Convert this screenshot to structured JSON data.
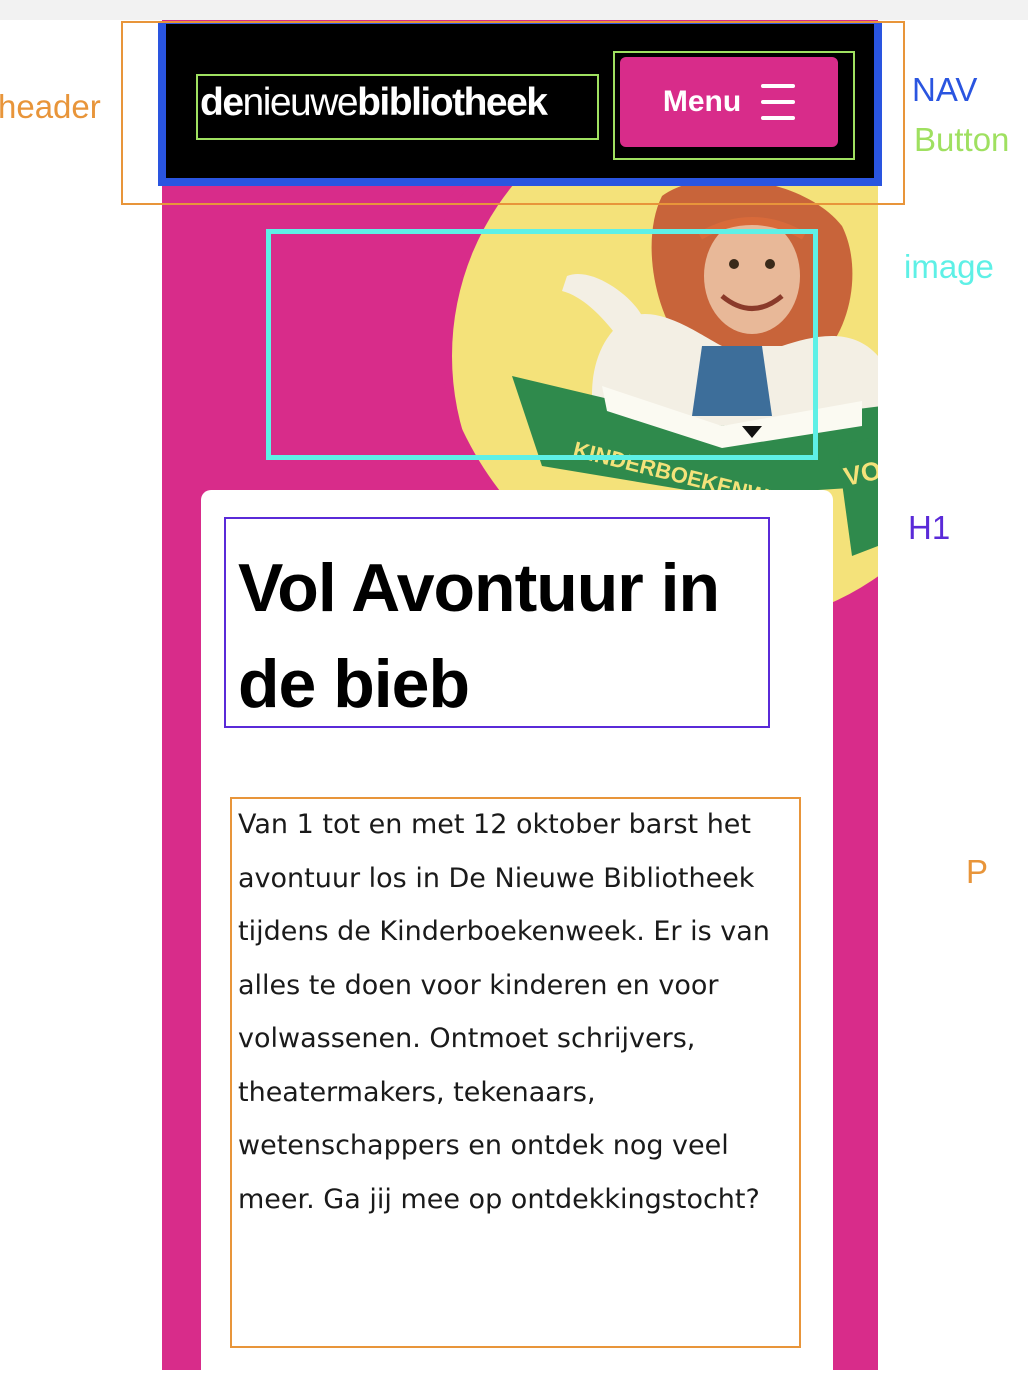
{
  "site": {
    "logo_de": "de",
    "logo_nieuwe": "nieuwe",
    "logo_bibliotheek": "bibliotheek",
    "menu_label": "Menu"
  },
  "content": {
    "heading": "Vol Avontuur in de bieb",
    "paragraph": "Van 1 tot en met 12 oktober barst het avontuur los in De Nieuwe Bibliotheek tijdens de Kinderboekenweek. Er is van alles te doen voor kinderen en voor volwassenen. Ontmoet schrijvers, theatermakers, tekenaars, wetenschappers en ontdek nog veel meer. Ga jij mee op ontdekkingstocht?"
  },
  "annotations": {
    "header": "header",
    "nav": "NAV",
    "button": "Button",
    "image": "image",
    "h1": "H1",
    "p": "P"
  },
  "illustration": {
    "book_text": "KINDERBOEKENWEEK",
    "side_text": "VOL"
  },
  "colors": {
    "brand_pink": "#d82c8a",
    "nav_black": "#000000",
    "nav_blue_outline": "#2a55e0",
    "header_annotation": "#e8953a",
    "button_annotation": "#9fe060",
    "image_annotation": "#5ef0e6",
    "h1_annotation": "#5a2ad8",
    "p_annotation": "#e8953a",
    "hero_yellow": "#f4e27a",
    "book_green": "#2f8a4c"
  },
  "icons": {
    "menu": "hamburger-icon"
  }
}
